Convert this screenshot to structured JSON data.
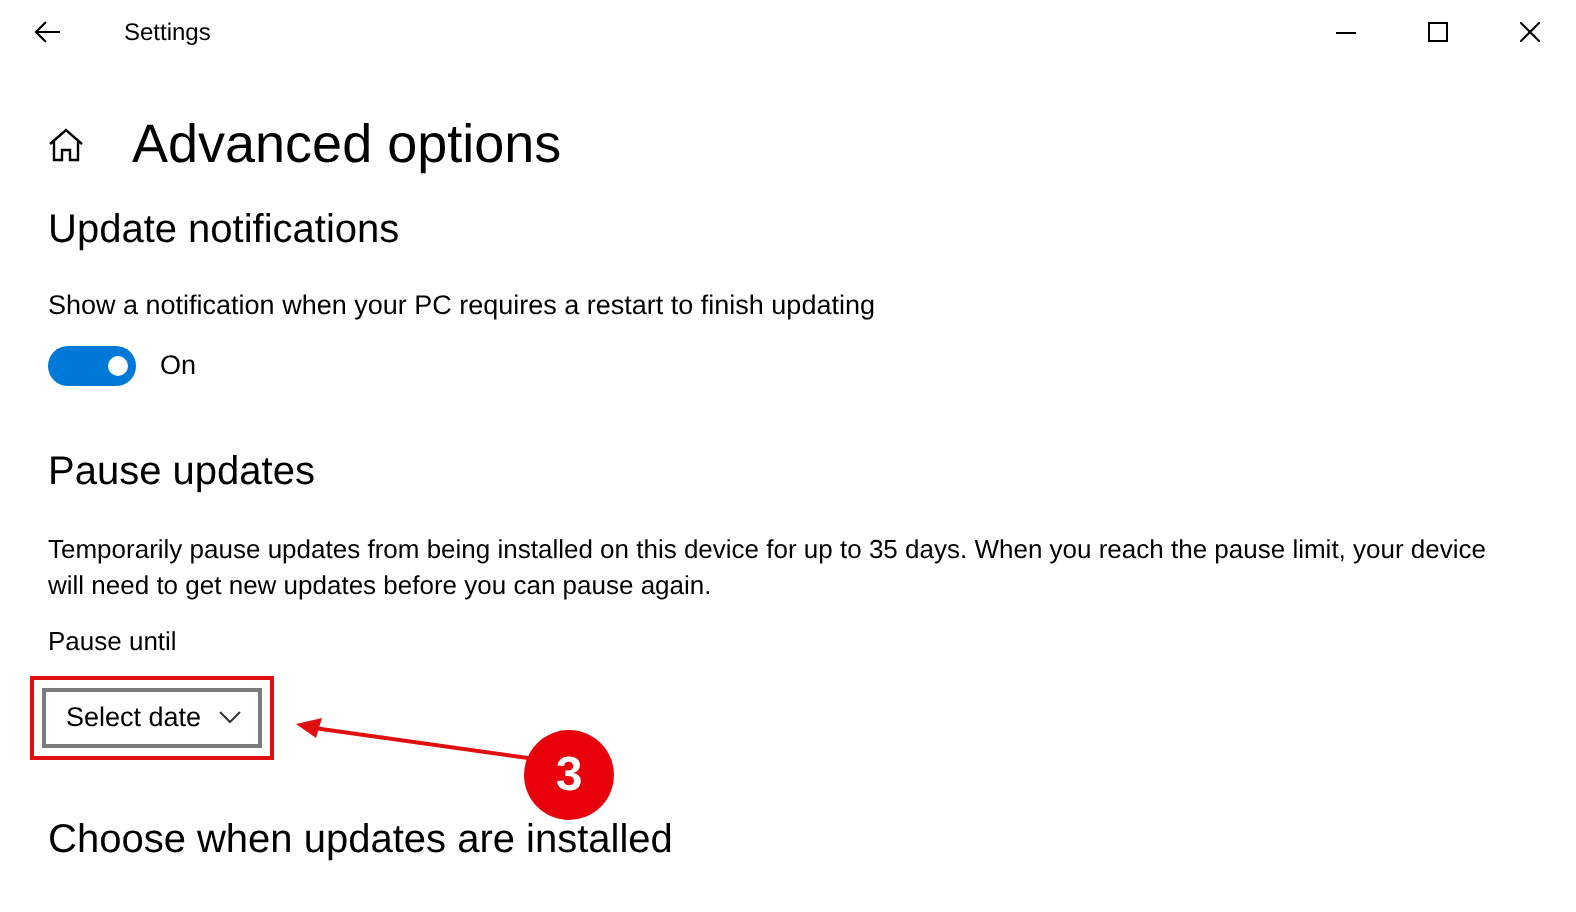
{
  "window": {
    "title": "Settings"
  },
  "page": {
    "title": "Advanced options"
  },
  "update_notifications": {
    "heading": "Update notifications",
    "description": "Show a notification when your PC requires a restart to finish updating",
    "toggle": {
      "on": true,
      "label": "On"
    }
  },
  "pause_updates": {
    "heading": "Pause updates",
    "description": "Temporarily pause updates from being installed on this device for up to 35 days. When you reach the pause limit, your device will need to get new updates before you can pause again.",
    "field_label": "Pause until",
    "dropdown": {
      "value": "Select date"
    }
  },
  "annotation": {
    "number": "3"
  },
  "next_section": {
    "heading": "Choose when updates are installed"
  }
}
